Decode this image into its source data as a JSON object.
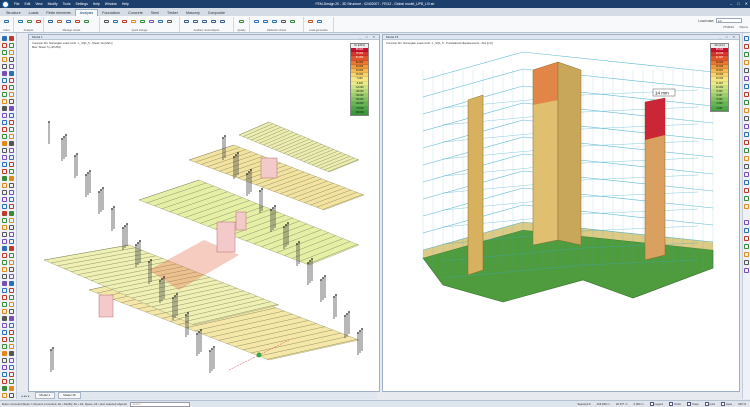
{
  "app": {
    "title": "FEM-Design 20 - 3D Structure - 02402007 - FEI12 - Global model_UPB_LIV.str",
    "menus": [
      "File",
      "Edit",
      "View",
      "Modify",
      "Tools",
      "Settings",
      "Help",
      "Window",
      "Help"
    ],
    "window_controls": [
      "–",
      "□",
      "✕"
    ]
  },
  "ribbon_tabs": [
    "Structure",
    "Loads",
    "Finite elements",
    "Analysis",
    "Foundation",
    "Concrete",
    "Steel",
    "Timber",
    "Masonry",
    "Composite"
  ],
  "active_tab": "Analysis",
  "ribbon": {
    "groups": [
      "Calcs",
      "Analysis",
      "Manage results",
      "Quick change",
      "Auxiliary result objects",
      "Quality",
      "Deflection check",
      "Load generation"
    ],
    "load_case_label": "Load case:",
    "load_case_value": "LC",
    "ptmesh_label": "PTMESH",
    "objects_label": "Objects"
  },
  "left_window": {
    "title": "Model 1",
    "controls": "_ □ ✕",
    "info_line1": "Concrete Shr. Norwegian Load comb.: L_SQ1_5 - Shear, Nx [kN/m]",
    "info_line2": "Max: Shear, 5 (+35.851)",
    "legend_top": "Nx [kN/m]",
    "legend_values": [
      "86.000",
      "75.000",
      "63.000",
      "52.000",
      "40.000",
      "30.000",
      "18.000",
      "7.000",
      "-5.000",
      "-16.000",
      "-28.000",
      "-39.000",
      "-50.000",
      "-62.000",
      "-73.000",
      "-84.000"
    ],
    "legend_colors": [
      "#c8102e",
      "#d9352a",
      "#e2542a",
      "#ea7630",
      "#f09a3c",
      "#f5ba50",
      "#f8d36a",
      "#f6e684",
      "#e6ec8a",
      "#cde483",
      "#b4da78",
      "#98cf6c",
      "#7ec261",
      "#63b554",
      "#4ca746",
      "#3a9a3a"
    ]
  },
  "right_window": {
    "title": "Model 15",
    "controls": "_ □ ✕",
    "info_line1": "Concrete Shr. Norwegian Load comb.: L_SQ1_5 - Translational displacements - Abs [mm]",
    "annotation": "14 mm",
    "legend_top": "Abs [mm]",
    "legend_values": [
      "25.000",
      "23.333",
      "21.667",
      "20.000",
      "18.333",
      "16.667",
      "15.000",
      "13.333",
      "11.667",
      "10.000",
      "8.333",
      "6.667",
      "5.000",
      "3.333",
      "1.667"
    ],
    "legend_colors": [
      "#c8102e",
      "#d9352a",
      "#e2542a",
      "#ea7630",
      "#f09a3c",
      "#f5ba50",
      "#f8d36a",
      "#f6e684",
      "#e6ec8a",
      "#cde483",
      "#b4da78",
      "#98cf6c",
      "#7ec261",
      "#63b554",
      "#4ca746"
    ]
  },
  "model_tabs": [
    "Model 1",
    "Model 15"
  ],
  "model_nav": "◂ ◂ ▸ ▸",
  "status": {
    "command": "Enter command (Enter = Assume command, Alt + Modify, Alt + Alt, Space, Alt + Esc selected objects)",
    "command_placeholder": "<Enter>",
    "items": [
      "Selected 0",
      "126.990 m",
      "26.677 m",
      "0.000 m",
      "Layers",
      "Ortho",
      "Snap",
      "Grid",
      "Axes",
      "100 %"
    ]
  },
  "colors": {
    "titlebar": "#1d3f6b",
    "accent": "#0b3c74",
    "result_red": "#c8102e",
    "result_green": "#3a9a3a",
    "frame_blue": "#3aa8c8"
  }
}
